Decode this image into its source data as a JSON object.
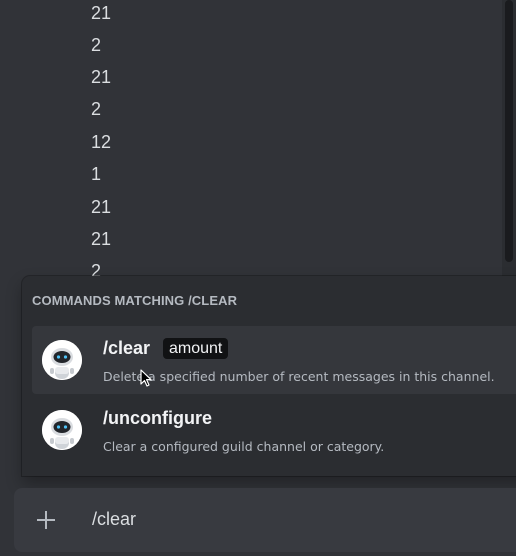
{
  "messages": [
    "21",
    "2",
    "21",
    "2",
    "12",
    "1",
    "21",
    "21",
    "2"
  ],
  "autocomplete": {
    "header": "COMMANDS MATCHING /CLEAR",
    "commands": [
      {
        "name": "/clear",
        "option": "amount",
        "description": "Delete a specified number of recent messages in this channel.",
        "selected": true,
        "icon": "robot-avatar"
      },
      {
        "name": "/unconfigure",
        "description": "Clear a configured guild channel or category.",
        "selected": false,
        "icon": "robot-avatar"
      }
    ]
  },
  "composer": {
    "value": "/clear",
    "add_icon": "plus-icon"
  },
  "colors": {
    "background": "#313338",
    "popup": "#2b2d31",
    "selected_row": "#35373c",
    "input": "#383a40",
    "option_pill": "#111214"
  }
}
